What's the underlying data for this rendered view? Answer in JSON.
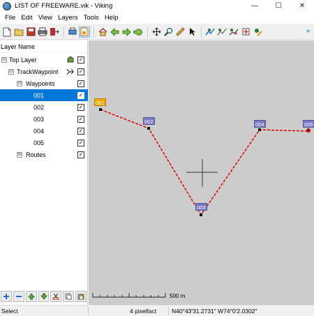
{
  "window": {
    "title": "LIST OF FREEWARE.vik - Viking",
    "controls": {
      "minimize": "—",
      "maximize": "☐",
      "close": "✕"
    }
  },
  "menu": {
    "items": [
      "File",
      "Edit",
      "View",
      "Layers",
      "Tools",
      "Help"
    ]
  },
  "toolbar": {
    "buttons": [
      "new-file-icon",
      "open-folder-icon",
      "save-icon",
      "print-icon",
      "exit-icon",
      "print-preview-icon",
      "layer-props-icon",
      "home-icon",
      "back-icon",
      "forward-icon",
      "goto-icon",
      "pan-icon",
      "zoom-icon",
      "ruler-icon",
      "select-icon",
      "create-track-icon",
      "create-route-icon",
      "edit-trackpoint-icon",
      "create-waypoint-icon",
      "edit-waypoint-icon"
    ],
    "more": "»"
  },
  "layers_panel": {
    "header": "Layer Name",
    "rows": [
      {
        "label": "Top Layer",
        "expander": "⊟",
        "checked": true,
        "selected": false
      },
      {
        "label": "TrackWaypoint",
        "expander": "⊟",
        "checked": true,
        "selected": false
      },
      {
        "label": "Waypoints",
        "expander": "⊟",
        "checked": true,
        "selected": false
      },
      {
        "label": "001",
        "checked": true,
        "selected": true
      },
      {
        "label": "002",
        "checked": true,
        "selected": false
      },
      {
        "label": "003",
        "checked": true,
        "selected": false
      },
      {
        "label": "004",
        "checked": true,
        "selected": false
      },
      {
        "label": "005",
        "checked": true,
        "selected": false
      },
      {
        "label": "Routes",
        "expander": "⊞",
        "checked": true,
        "selected": false
      }
    ],
    "bottom_buttons": [
      "add-icon",
      "remove-icon",
      "move-up-icon",
      "move-down-icon",
      "cut-icon",
      "copy-icon",
      "paste-icon"
    ]
  },
  "map": {
    "background": "#cccccc",
    "waypoints": [
      "001",
      "002",
      "003",
      "004",
      "005"
    ],
    "selected_waypoint": "001",
    "route_color": "#e00000",
    "scale_label": "500 m"
  },
  "statusbar": {
    "tool": "Select",
    "zoom": "4 pixelfact",
    "coords": "N40°43'31.2731\" W74°0'2.0302\""
  }
}
